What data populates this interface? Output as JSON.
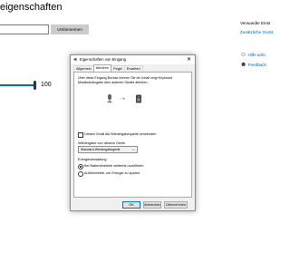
{
  "page": {
    "title": "eigenschaften",
    "rename_button": "Umbenennen",
    "volume_value": "100",
    "related_heading": "Verwandte Einst",
    "related_link": "Zusätzliche Gerät",
    "help_link": "Hilfe anfo",
    "feedback_link": "Feedback",
    "accent_color": "#0067b8"
  },
  "dialog": {
    "title": "Eigenschaften von Eingang",
    "tabs": [
      {
        "label": "Allgemein"
      },
      {
        "label": "Abhören"
      },
      {
        "label": "Pegel"
      },
      {
        "label": "Erweitert"
      }
    ],
    "description": "Über diese Eingang Buchse können Sie ein Inhalt zeigt Keyboard Musikwiedergabe über anderen Geräte abhören.",
    "listen_checkbox": "Dieses Gerät als Wiedergabequelle verwenden",
    "playback_label": "Wiedergabe von diesem Gerät:",
    "playback_value": "Standard-Wiedergabegerät",
    "power_label": "Energieverwaltung",
    "radio_1": "Bei Batteriebetrieb weiterhin ausführen",
    "radio_2": "Außerbetrieb, um Energie zu sparen",
    "buttons": {
      "ok": "OK",
      "cancel": "Abbrechen",
      "apply": "Übernehmen"
    }
  }
}
